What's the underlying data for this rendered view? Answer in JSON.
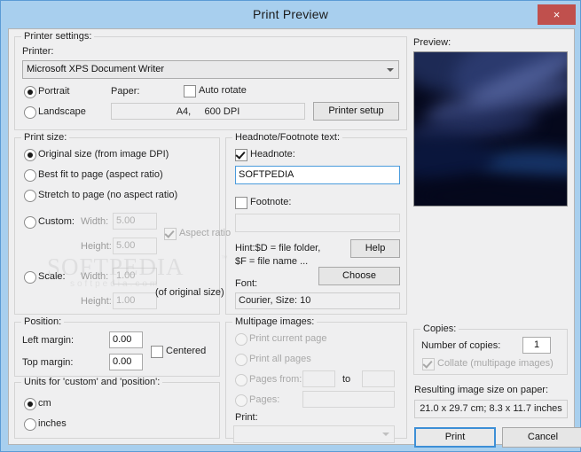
{
  "window": {
    "title": "Print Preview",
    "close_label": "×",
    "titlebar_color": "#a8cfee",
    "close_color": "#c0504d"
  },
  "printer_settings": {
    "group_label": "Printer settings:",
    "printer_label": "Printer:",
    "printer_value": "Microsoft XPS Document Writer",
    "orientation": {
      "portrait": "Portrait",
      "landscape": "Landscape",
      "selected": "Portrait"
    },
    "paper_label": "Paper:",
    "auto_rotate_label": "Auto rotate",
    "auto_rotate_checked": false,
    "paper_size": "A4,",
    "paper_dpi": "600 DPI",
    "printer_setup_button": "Printer setup"
  },
  "print_size": {
    "group_label": "Print size:",
    "options": [
      {
        "label": "Original size (from image DPI)",
        "selected": true
      },
      {
        "label": "Best fit to page (aspect ratio)",
        "selected": false
      },
      {
        "label": "Stretch to page (no aspect ratio)",
        "selected": false
      },
      {
        "label": "Custom:",
        "selected": false
      },
      {
        "label": "Scale:",
        "selected": false
      }
    ],
    "custom_width_label": "Width:",
    "custom_width_value": "5.00",
    "custom_height_label": "Height:",
    "custom_height_value": "5.00",
    "aspect_ratio_label": "Aspect ratio",
    "aspect_ratio_checked": true,
    "scale_width_label": "Width:",
    "scale_width_value": "1.00",
    "scale_height_label": "Height:",
    "scale_height_value": "1.00",
    "of_original_size_label": "(of original size)"
  },
  "headnote_footnote": {
    "group_label": "Headnote/Footnote text:",
    "headnote_label": "Headnote:",
    "headnote_checked": true,
    "headnote_value": "SOFTPEDIA",
    "footnote_label": "Footnote:",
    "footnote_checked": false,
    "footnote_value": "",
    "hint_line1": "Hint:$D = file folder,",
    "hint_line2": "$F = file name ...",
    "help_button": "Help",
    "choose_button": "Choose",
    "font_label": "Font:",
    "font_value": "Courier, Size: 10"
  },
  "position": {
    "group_label": "Position:",
    "left_margin_label": "Left margin:",
    "left_margin_value": "0.00",
    "top_margin_label": "Top margin:",
    "top_margin_value": "0.00",
    "centered_label": "Centered",
    "centered_checked": false
  },
  "units": {
    "group_label": "Units for 'custom' and 'position':",
    "options": [
      {
        "label": "cm",
        "selected": true
      },
      {
        "label": "inches",
        "selected": false
      }
    ]
  },
  "multipage": {
    "group_label": "Multipage images:",
    "options": [
      {
        "label": "Print current page",
        "selected": false
      },
      {
        "label": "Print all pages",
        "selected": false
      },
      {
        "label": "Pages from:",
        "selected": false
      },
      {
        "label": "Pages:",
        "selected": false
      }
    ],
    "to_label": "to",
    "pages_from_value": "",
    "pages_to_value": "",
    "pages_value": "",
    "print_label": "Print:",
    "print_value": ""
  },
  "preview": {
    "label": "Preview:"
  },
  "copies": {
    "group_label": "Copies:",
    "number_label": "Number of copies:",
    "number_value": "1",
    "collate_label": "Collate (multipage images)",
    "collate_checked": true
  },
  "result": {
    "label": "Resulting image size on paper:",
    "value": "21.0 x 29.7 cm; 8.3 x 11.7 inches"
  },
  "actions": {
    "print_button": "Print",
    "cancel_button": "Cancel"
  },
  "watermark": {
    "main": "SOFTPEDIA",
    "sub": "softpedia.com",
    "tm": "™"
  }
}
